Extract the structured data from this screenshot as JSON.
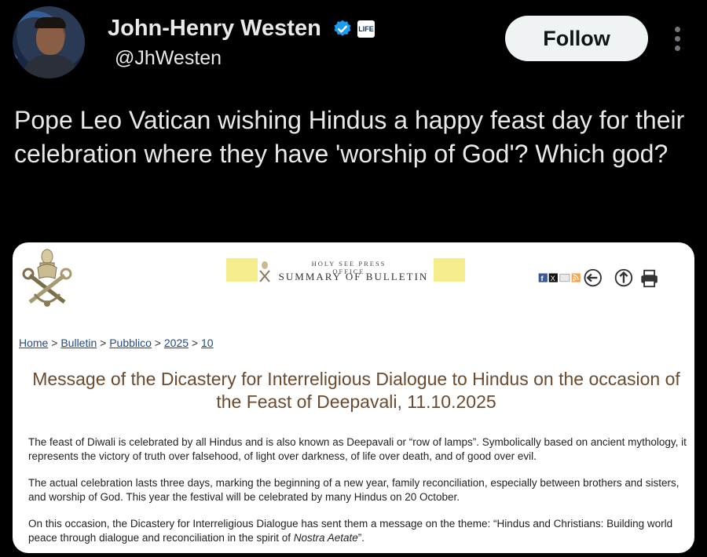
{
  "author": {
    "name": "John-Henry Westen",
    "handle": "@JhWesten",
    "badge": "LIFE",
    "verified_color": "#1d9bf0"
  },
  "follow_label": "Follow",
  "tweet_text": "Pope Leo Vatican wishing Hindus a happy feast day for their celebration where they have 'worship of God'? Which god?",
  "card": {
    "office_label": "HOLY SEE PRESS OFFICE",
    "bulletin_label": "SUMMARY OF BULLETIN",
    "breadcrumb": [
      "Home",
      "Bulletin",
      "Pubblico",
      "2025",
      "10"
    ],
    "breadcrumb_sep": " > ",
    "title": "Message of the Dicastery for Interreligious Dialogue to Hindus on the occasion of the Feast of Deepavali, 11.10.2025",
    "p1": "The feast of Diwali is celebrated by all Hindus and is also known as Deepavali or “row of lamps”. Symbolically based on ancient mythology, it represents the victory of truth over falsehood, of light over darkness, of life over death, and of good over evil.",
    "p2": "The actual celebration lasts three days, marking the beginning of a new year, family reconciliation, especially between brothers and sisters, and worship of God. This year the festival will be celebrated by many Hindus on 20 October.",
    "p3_start": "On this occasion, the Dicastery for Interreligious Dialogue has sent them a message on the theme: “Hindus and Christians: Building world peace through dialogue and reconciliation in the spirit of ",
    "p3_italic": "Nostra Aetate",
    "p3_end": "”.",
    "share_icons": [
      "facebook-icon",
      "x-icon",
      "email-icon",
      "rss-icon",
      "back-icon",
      "top-icon",
      "print-icon"
    ]
  }
}
